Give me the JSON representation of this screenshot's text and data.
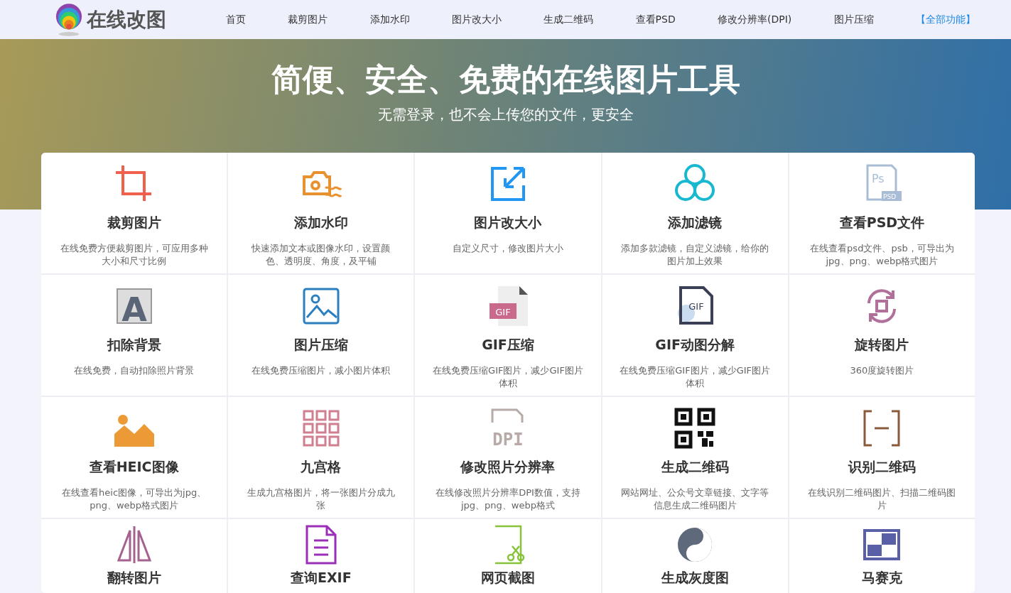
{
  "header": {
    "logo_text": "在线改图",
    "nav": [
      {
        "label": "首页",
        "kind": "normal"
      },
      {
        "label": "裁剪图片",
        "kind": "normal"
      },
      {
        "label": "添加水印",
        "kind": "normal"
      },
      {
        "label": "图片改大小",
        "kind": "normal"
      },
      {
        "label": "生成二维码",
        "kind": "normal"
      },
      {
        "label": "查看PSD",
        "kind": "normal"
      },
      {
        "label": "修改分辨率(DPI)",
        "kind": "normal"
      },
      {
        "label": "图片压缩",
        "kind": "normal"
      },
      {
        "label": "【全部功能】",
        "kind": "highlight"
      }
    ]
  },
  "hero": {
    "title": "简便、安全、免费的在线图片工具",
    "subtitle": "无需登录，也不会上传您的文件，更安全"
  },
  "tools": [
    {
      "title": "裁剪图片",
      "desc": "在线免费方便裁剪图片，可应用多种大小和尺寸比例"
    },
    {
      "title": "添加水印",
      "desc": "快速添加文本或图像水印，设置颜色、透明度、角度，及平铺"
    },
    {
      "title": "图片改大小",
      "desc": "自定义尺寸，修改图片大小"
    },
    {
      "title": "添加滤镜",
      "desc": "添加多款滤镜，自定义滤镜，给你的图片加上效果"
    },
    {
      "icon_text": [
        "Ps",
        "PSD"
      ],
      "title": "查看PSD文件",
      "desc": "在线查看psd文件、psb，可导出为jpg、png、webp格式图片"
    },
    {
      "icon_text": [
        "A"
      ],
      "title": "扣除背景",
      "desc": "在线免费，自动扣除照片背景"
    },
    {
      "title": "图片压缩",
      "desc": "在线免费压缩图片，减小图片体积"
    },
    {
      "icon_text": [
        "GIF"
      ],
      "title": "GIF压缩",
      "desc": "在线免费压缩GIF图片，减少GIF图片体积"
    },
    {
      "icon_text": [
        "GIF"
      ],
      "title": "GIF动图分解",
      "desc": "在线免费压缩GIF图片，减少GIF图片体积"
    },
    {
      "title": "旋转图片",
      "desc": "360度旋转图片"
    },
    {
      "title": "查看HEIC图像",
      "desc": "在线查看heic图像，可导出为jpg、png、webp格式图片"
    },
    {
      "title": "九宫格",
      "desc": "生成九宫格图片，将一张图片分成九张"
    },
    {
      "icon_text": [
        "DPI"
      ],
      "title": "修改照片分辨率",
      "desc": "在线修改照片分辨率DPI数值，支持jpg、png、webp格式"
    },
    {
      "title": "生成二维码",
      "desc": "网站网址、公众号文章链接、文字等信息生成二维码图片"
    },
    {
      "title": "识别二维码",
      "desc": "在线识别二维码图片、扫描二维码图片"
    },
    {
      "title": "翻转图片"
    },
    {
      "title": "查询EXIF"
    },
    {
      "title": "网页截图"
    },
    {
      "title": "生成灰度图"
    },
    {
      "title": "马赛克"
    }
  ]
}
